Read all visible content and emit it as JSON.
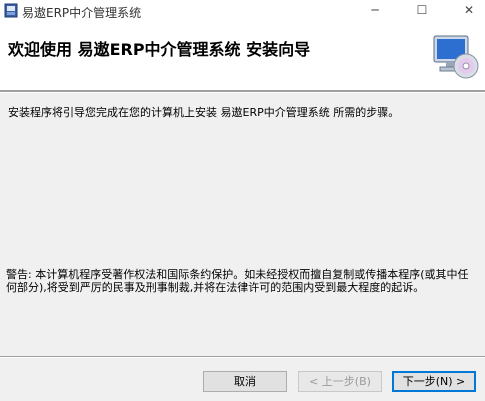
{
  "window": {
    "title": "易遨ERP中介管理系统",
    "controls": {
      "minimize": "─",
      "maximize": "☐",
      "close": "✕"
    }
  },
  "banner": {
    "heading": "欢迎使用 易遨ERP中介管理系统 安装向导"
  },
  "content": {
    "intro": "安装程序将引导您完成在您的计算机上安装 易遨ERP中介管理系统 所需的步骤。",
    "warning": "警告: 本计算机程序受著作权法和国际条约保护。如未经授权而擅自复制或传播本程序(或其中任何部分),将受到严厉的民事及刑事制裁,并将在法律许可的范围内受到最大程度的起诉。"
  },
  "buttons": {
    "cancel": "取消",
    "back": "< 上一步(B)",
    "next": "下一步(N) >"
  }
}
